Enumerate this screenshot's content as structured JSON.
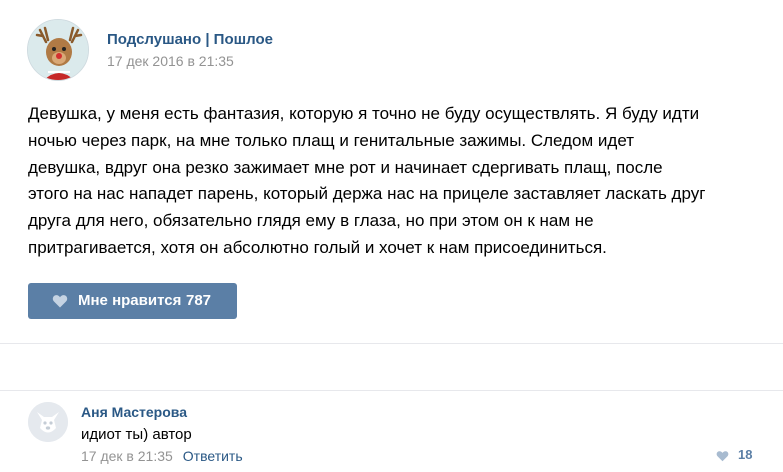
{
  "post": {
    "author": "Подслушано | Пошлое",
    "date": "17 дек 2016 в 21:35",
    "lines": [
      "Девушка, у меня есть фантазия, которую я точно не буду осуществлять. Я буду идти",
      "ночью через парк, на мне только плащ и генитальные зажимы. Следом идет",
      "девушка, вдруг она резко зажимает мне рот и начинает сдергивать плащ, после",
      "этого на нас нападет парень, который держа нас на прицеле заставляет ласкать друг",
      "друга для него, обязательно глядя ему в глаза, но при этом он к нам не",
      "притрагивается, хотя он абсолютно голый и хочет к нам присоединиться."
    ],
    "like_label": "Мне нравится",
    "like_count": "787"
  },
  "comment": {
    "author": "Аня Мастерова",
    "text": "идиот ты) автор",
    "date": "17 дек в 21:35",
    "reply_label": "Ответить",
    "like_count": "18"
  },
  "icons": {
    "post_avatar": "reindeer-avatar-icon",
    "comment_avatar": "default-dog-avatar-icon",
    "like": "heart-icon"
  },
  "colors": {
    "link": "#2a5885",
    "like_button": "#5b7fa6",
    "meta": "#939393",
    "divider": "#e7e8ec"
  }
}
